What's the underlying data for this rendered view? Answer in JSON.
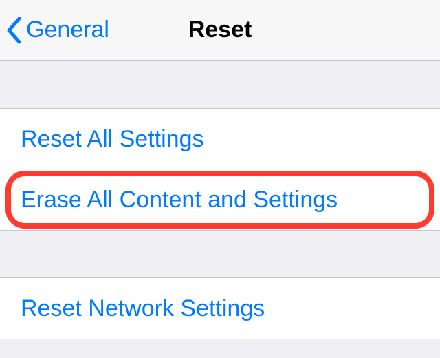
{
  "nav": {
    "back_label": "General",
    "title": "Reset"
  },
  "items": [
    {
      "label": "Reset All Settings"
    },
    {
      "label": "Erase All Content and Settings"
    },
    {
      "label": "Reset Network Settings"
    }
  ]
}
